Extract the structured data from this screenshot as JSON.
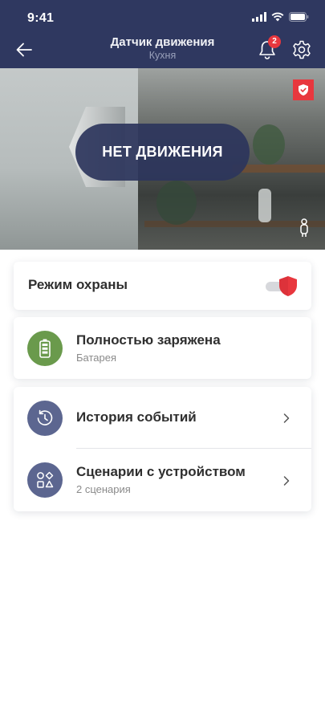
{
  "status_bar": {
    "time": "9:41"
  },
  "nav": {
    "title": "Датчик движения",
    "subtitle": "Кухня",
    "notification_count": "2"
  },
  "camera": {
    "status_label": "НЕТ ДВИЖЕНИЯ"
  },
  "guard": {
    "label": "Режим охраны",
    "enabled": true
  },
  "battery": {
    "title": "Полностью заряжена",
    "subtitle": "Батарея"
  },
  "links": [
    {
      "title": "История событий",
      "icon": "history-icon"
    },
    {
      "title": "Сценарии с устройством",
      "subtitle": "2 сценария",
      "icon": "scenarios-icon"
    }
  ],
  "colors": {
    "header_bg": "#2f3860",
    "accent_red": "#e8373e",
    "battery_green": "#6a9a4c",
    "icon_indigo": "#5c6690"
  }
}
